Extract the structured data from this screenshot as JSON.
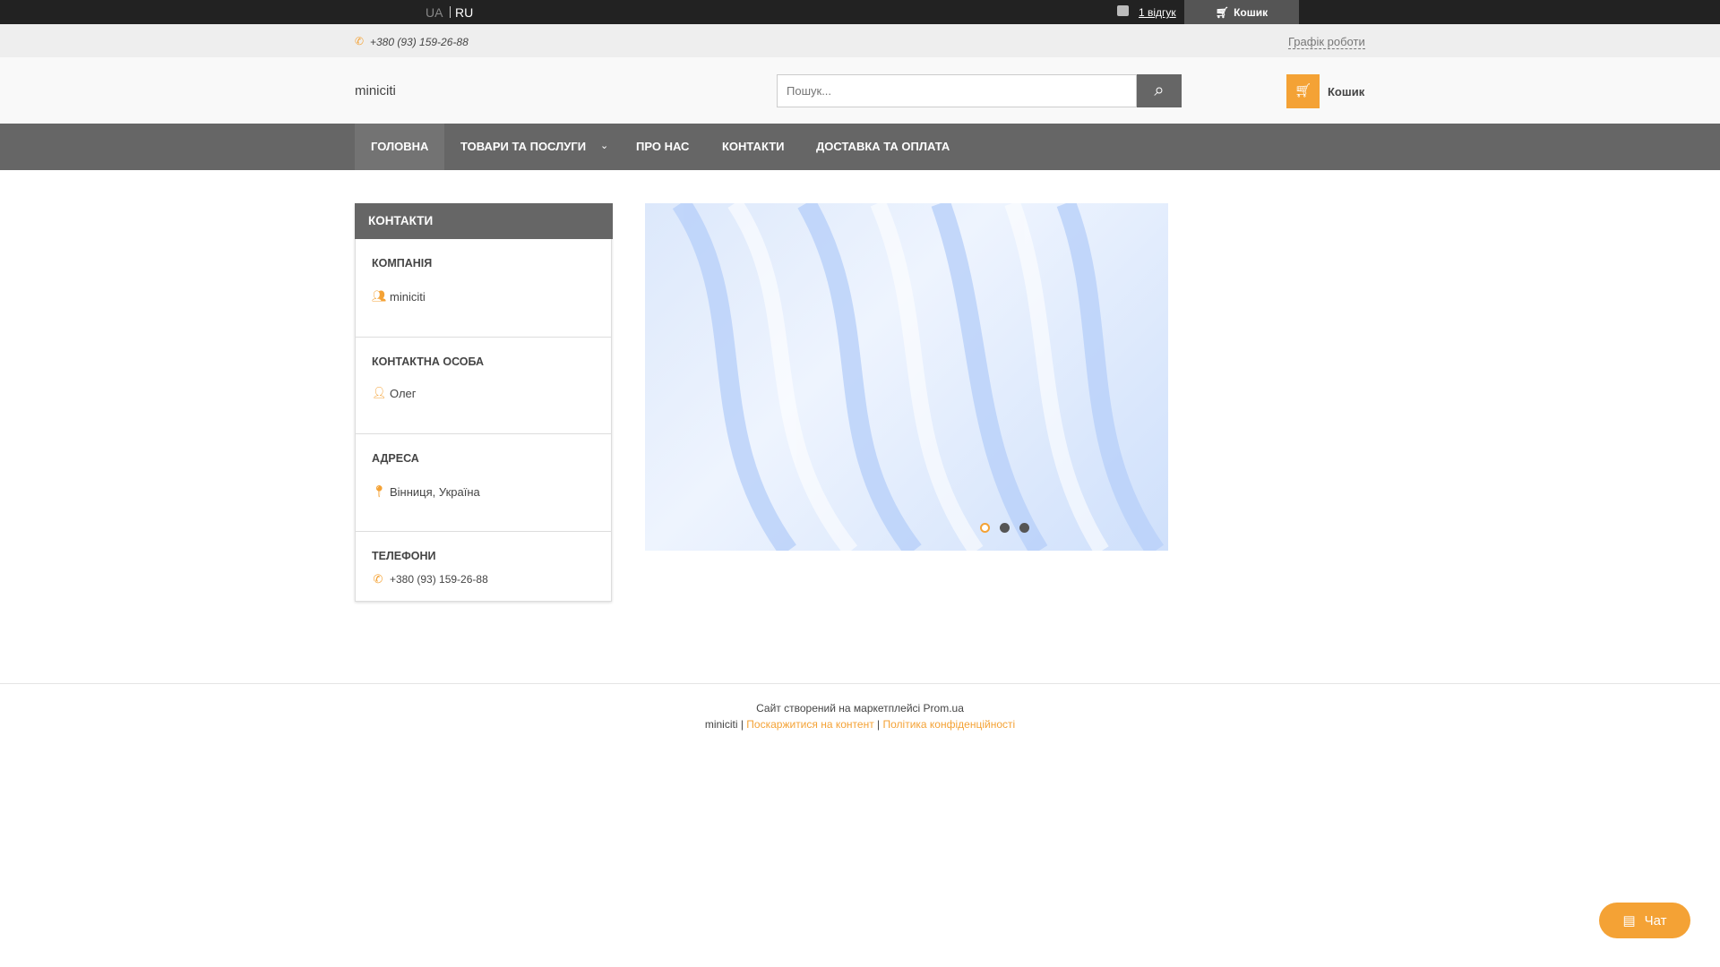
{
  "topbar": {
    "lang_ua": "UA",
    "lang_ru": "RU",
    "reviews": "1 відгук",
    "cart": "Кошик"
  },
  "subbar": {
    "phone": "+380 (93) 159-26-88",
    "schedule": "Графік роботи"
  },
  "header": {
    "logo": "miniciti",
    "search_placeholder": "Пошук...",
    "cart": "Кошик"
  },
  "nav": {
    "items": [
      "ГОЛОВНА",
      "ТОВАРИ ТА ПОСЛУГИ",
      "ПРО НАС",
      "КОНТАКТИ",
      "ДОСТАВКА ТА ОПЛАТА"
    ]
  },
  "contacts": {
    "title": "КОНТАКТИ",
    "sections": [
      {
        "heading": "КОМПАНІЯ",
        "value": "miniciti",
        "icon": "company-icon"
      },
      {
        "heading": "КОНТАКТНА ОСОБА",
        "value": "Олег",
        "icon": "person-icon"
      },
      {
        "heading": "АДРЕСА",
        "value": "Вінниця, Україна",
        "icon": "location-pin-icon"
      },
      {
        "heading": "ТЕЛЕФОНИ",
        "value": "+380 (93) 159-26-88",
        "icon": "phone-icon"
      }
    ]
  },
  "banner": {
    "slides": 3,
    "active": 1
  },
  "footer": {
    "created": "Сайт створений на маркетплейсі Prom.ua",
    "company": "miniciti",
    "complain": "Поскаржитися на контент",
    "privacy": "Політика конфіденційності"
  },
  "chat": {
    "label": "Чат"
  },
  "colors": {
    "accent": "#f4a235",
    "dark": "#222222",
    "nav": "#666666"
  }
}
